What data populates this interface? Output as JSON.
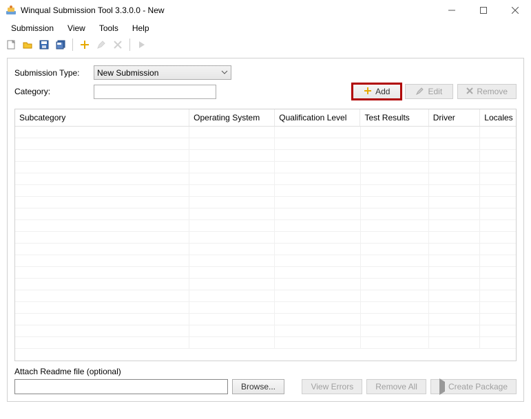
{
  "window": {
    "title": "Winqual Submission Tool 3.3.0.0 - New"
  },
  "menubar": {
    "items": [
      "Submission",
      "View",
      "Tools",
      "Help"
    ]
  },
  "form": {
    "submission_type_label": "Submission Type:",
    "submission_type_value": "New Submission",
    "category_label": "Category:",
    "category_value": ""
  },
  "actions": {
    "add": "Add",
    "edit": "Edit",
    "remove": "Remove"
  },
  "grid": {
    "columns": [
      "Subcategory",
      "Operating System",
      "Qualification Level",
      "Test Results",
      "Driver",
      "Locales"
    ],
    "rows": []
  },
  "attach": {
    "label": "Attach Readme file (optional)",
    "value": "",
    "browse": "Browse..."
  },
  "footer": {
    "view_errors": "View Errors",
    "remove_all": "Remove All",
    "create_package": "Create Package"
  }
}
